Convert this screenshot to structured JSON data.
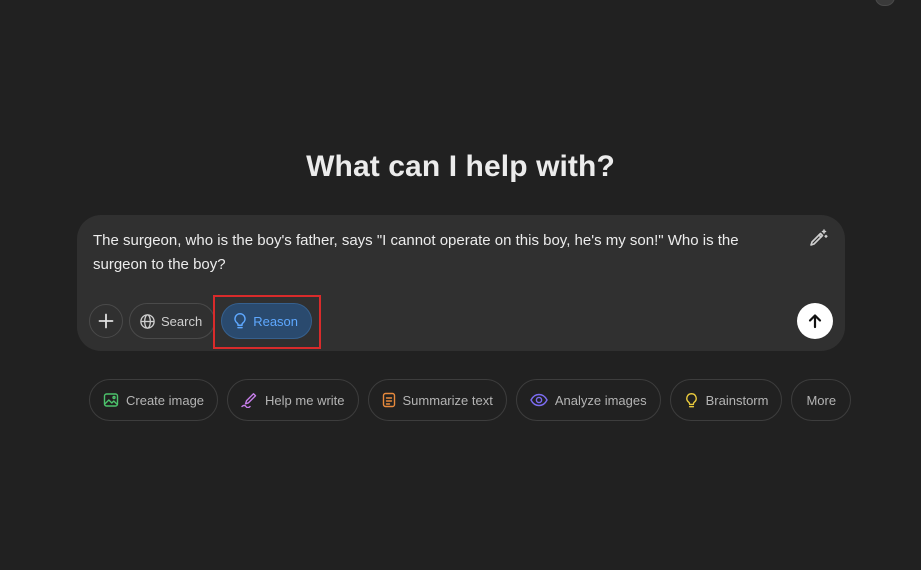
{
  "headline": "What can I help with?",
  "composer": {
    "prompt_text": "The surgeon, who is the boy's father, says \"I cannot operate on this boy, he's my son!\" Who is the surgeon to the boy?",
    "toolbar": {
      "add_icon": "plus-icon",
      "search_label": "Search",
      "search_icon": "globe-icon",
      "reason_label": "Reason",
      "reason_icon": "lightbulb-icon",
      "reason_active": true,
      "send_icon": "arrow-up-icon",
      "edit_icon": "magic-pen-icon"
    }
  },
  "suggestions": [
    {
      "label": "Create image",
      "icon": "image-icon",
      "color": "#4cc26b"
    },
    {
      "label": "Help me write",
      "icon": "pen-icon",
      "color": "#c57de8"
    },
    {
      "label": "Summarize text",
      "icon": "document-icon",
      "color": "#e88a3c"
    },
    {
      "label": "Analyze images",
      "icon": "eye-icon",
      "color": "#7b6cf0"
    },
    {
      "label": "Brainstorm",
      "icon": "lightbulb-icon",
      "color": "#e8c93c"
    },
    {
      "label": "More",
      "icon": "",
      "color": "#b4b4b4"
    }
  ],
  "colors": {
    "background": "#212121",
    "composer": "#303030",
    "reason_accent": "#5ea8ff",
    "highlight": "#d92b2b"
  }
}
